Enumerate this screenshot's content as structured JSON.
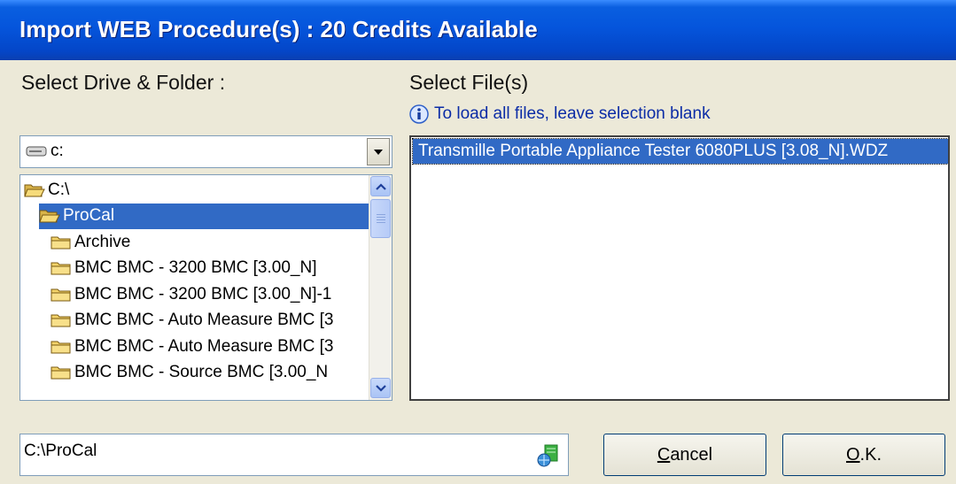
{
  "window": {
    "title": "Import WEB Procedure(s) : 20 Credits Available"
  },
  "drive_label": "Select Drive & Folder :",
  "files_label": "Select File(s)",
  "info_text": "To load all files, leave selection blank",
  "drive_combo": {
    "value": "c:",
    "icon": "drive-icon"
  },
  "folders": [
    {
      "name": "C:\\",
      "selected": false,
      "indent": 0,
      "open": true
    },
    {
      "name": "ProCal",
      "selected": true,
      "indent": 1,
      "open": true
    },
    {
      "name": "Archive",
      "selected": false,
      "indent": 2,
      "open": false
    },
    {
      "name": "BMC BMC - 3200 BMC [3.00_N]",
      "selected": false,
      "indent": 2,
      "open": false
    },
    {
      "name": "BMC BMC - 3200 BMC [3.00_N]-1",
      "selected": false,
      "indent": 2,
      "open": false
    },
    {
      "name": "BMC BMC - Auto Measure BMC [3",
      "selected": false,
      "indent": 2,
      "open": false
    },
    {
      "name": "BMC BMC - Auto Measure BMC [3",
      "selected": false,
      "indent": 2,
      "open": false
    },
    {
      "name": "BMC BMC - Source BMC [3.00_N",
      "selected": false,
      "indent": 2,
      "open": false
    }
  ],
  "files": [
    "Transmille Portable Appliance Tester 6080PLUS [3.08_N].WDZ"
  ],
  "path": {
    "value": "C:\\ProCal"
  },
  "buttons": {
    "cancel": "Cancel",
    "ok": "O.K."
  },
  "colors": {
    "titlebar": "#0555DC",
    "selection": "#316AC5",
    "dialog_bg": "#ECE9D8",
    "info_text": "#0B2CA6"
  }
}
